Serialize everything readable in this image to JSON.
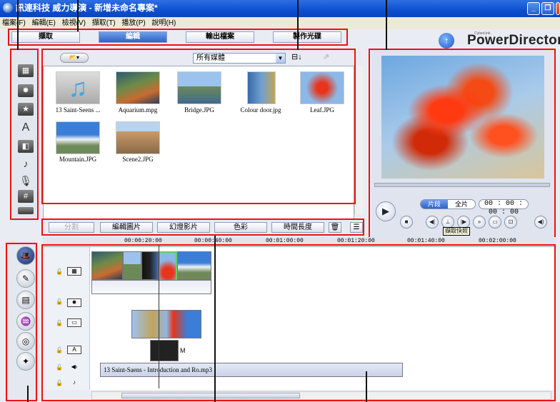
{
  "title": "訊連科技 威力導演 - 新增未命名專案*",
  "menu": [
    "檔案(F)",
    "編輯(E)",
    "檢視(V)",
    "擷取(T)",
    "播放(P)",
    "說明(H)"
  ],
  "tabs": [
    {
      "label": "擷取",
      "active": false
    },
    {
      "label": "編輯",
      "active": true
    },
    {
      "label": "輸出檔案",
      "active": false
    },
    {
      "label": "製作光碟",
      "active": false
    }
  ],
  "brand": {
    "name": "PowerDirector",
    "small": "CyberLink"
  },
  "library": {
    "filter": "所有媒體",
    "items": [
      {
        "name": "13 Saint-Seens ...",
        "kind": "audio"
      },
      {
        "name": "Aquarium.mpg",
        "kind": "video"
      },
      {
        "name": "Bridge.JPG",
        "kind": "image"
      },
      {
        "name": "Colour door.jpg",
        "kind": "image"
      },
      {
        "name": "Leaf.JPG",
        "kind": "image"
      },
      {
        "name": "Mountain.JPG",
        "kind": "image"
      },
      {
        "name": "Scene2.JPG",
        "kind": "image"
      }
    ]
  },
  "midbar": {
    "buttons": [
      "分割",
      "編輯圖片",
      "幻燈影片",
      "色彩",
      "時間長度"
    ]
  },
  "preview": {
    "mode_clip": "片段",
    "mode_movie": "全片",
    "timecode": "00 : 00 : 00 : 00",
    "tooltip": "擷取快照"
  },
  "timeline": {
    "ticks": [
      "00:00:20:00",
      "00:00:40:00",
      "00:01:00:00",
      "00:01:20:00",
      "00:01:40:00",
      "00:02:00:00"
    ],
    "audio_clip": "13 Saint-Saens - Introduction and Ro.mp3",
    "title_clip_marker": "M"
  }
}
